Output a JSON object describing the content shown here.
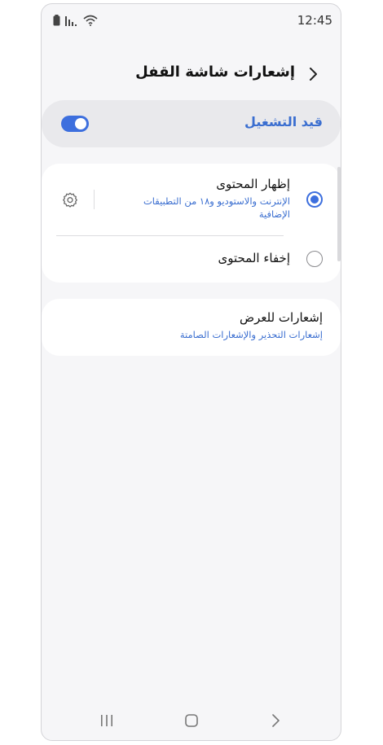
{
  "status_bar": {
    "time": "12:45",
    "icons": [
      "battery-icon",
      "signal-icon",
      "wifi-icon"
    ]
  },
  "header": {
    "title": "إشعارات شاشة القفل",
    "back_icon": "chevron-right-icon"
  },
  "master_switch": {
    "label": "قيد التشغيل",
    "on": true
  },
  "content_options": [
    {
      "title": "إظهار المحتوى",
      "subtitle": "الإنترنت والاستوديو و١٨ من التطبيقات الإضافية",
      "selected": true,
      "settings_icon": "gear-icon"
    },
    {
      "title": "إخفاء المحتوى",
      "selected": false
    }
  ],
  "notifications_to_show": {
    "title": "إشعارات للعرض",
    "subtitle": "إشعارات التحذير والإشعارات الصامتة"
  },
  "navigation_bar": {
    "buttons": [
      "recents-icon",
      "home-icon",
      "back-icon"
    ]
  },
  "colors": {
    "accent": "#3d6fde",
    "accent_text": "#3a6ed0",
    "background": "#f6f6f8",
    "card": "#ffffff"
  }
}
